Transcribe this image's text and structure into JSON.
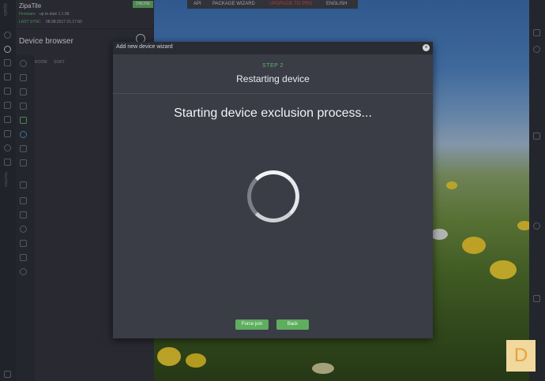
{
  "app": {
    "name": "ZipaTile",
    "firmware_label": "Firmware",
    "firmware_status": "up to date 1.1.58",
    "last_sync_label": "LAST SYNC",
    "last_sync_value": "08.08.2017 21:17:60",
    "online_badge": "ONLINE",
    "vertical_brand": "zipato"
  },
  "top_nav": {
    "items": [
      "API",
      "PACKAGE WIZARD",
      "UPGRADE TO PRO",
      "ENGLISH"
    ]
  },
  "device_browser": {
    "title": "Device browser",
    "filters": [
      "ROOM",
      "SORT"
    ],
    "vertical_label": "favorites"
  },
  "modal": {
    "title": "Add new device wizard",
    "close_glyph": "×",
    "step_label": "STEP 2",
    "heading": "Restarting device",
    "message": "Starting device exclusion process...",
    "buttons": {
      "force_join": "Force join",
      "back": "Back"
    }
  },
  "logo_letter": "D",
  "colors": {
    "accent_green": "#5fad5f",
    "upgrade_red": "#c0392b",
    "modal_bg": "#3a3c46"
  }
}
